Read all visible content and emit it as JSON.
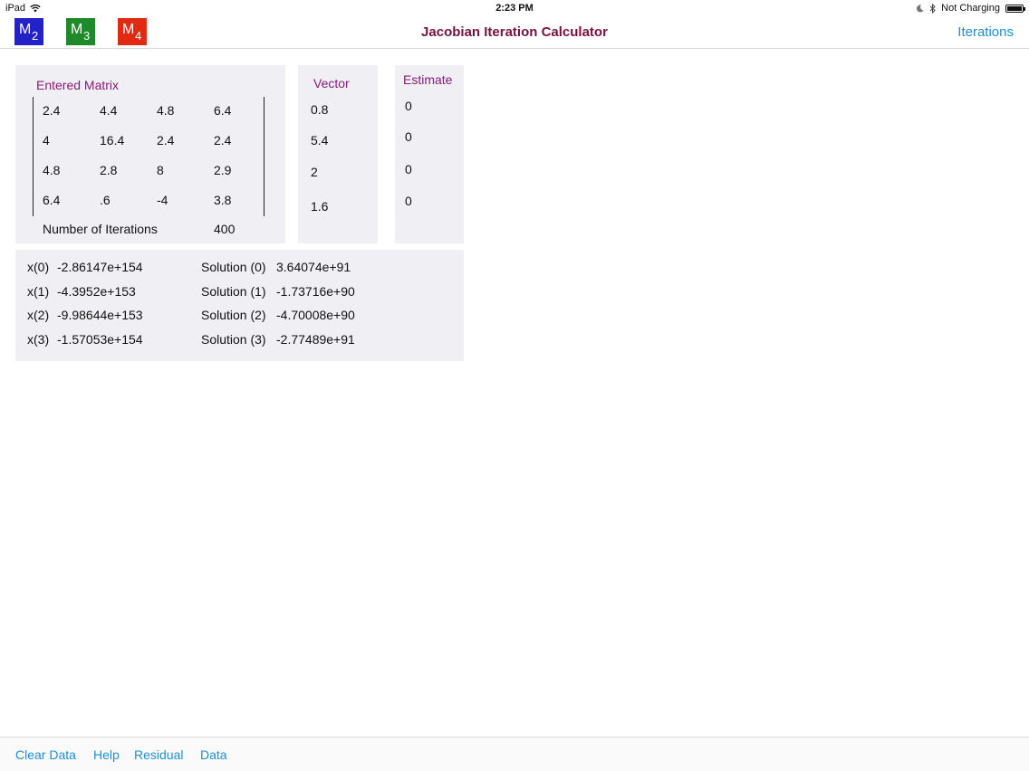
{
  "status_bar": {
    "device": "iPad",
    "time": "2:23 PM",
    "charging": "Not Charging"
  },
  "nav": {
    "title": "Jacobian Iteration Calculator",
    "right_button": "Iterations",
    "buttons": [
      {
        "letter": "M",
        "sub": "2",
        "color": "#2222c8"
      },
      {
        "letter": "M",
        "sub": "3",
        "color": "#1e8a2a"
      },
      {
        "letter": "M",
        "sub": "4",
        "color": "#e02a12"
      }
    ]
  },
  "matrix": {
    "title": "Entered Matrix",
    "rows": [
      [
        "2.4",
        "4.4",
        "4.8",
        "6.4"
      ],
      [
        "4",
        "16.4",
        "2.4",
        "2.4"
      ],
      [
        "4.8",
        "2.8",
        "8",
        "2.9"
      ],
      [
        "6.4",
        ".6",
        "-4",
        "3.8"
      ]
    ],
    "iterations_label": "Number of Iterations",
    "iterations_value": "400"
  },
  "vector": {
    "title": "Vector",
    "values": [
      "0.8",
      "5.4",
      "2",
      "1.6"
    ]
  },
  "estimate": {
    "title": "Estimate",
    "values": [
      "0",
      "0",
      "0",
      "0"
    ]
  },
  "results": {
    "x": [
      {
        "label": "x(0)",
        "value": "-2.86147e+154"
      },
      {
        "label": "x(1)",
        "value": "-4.3952e+153"
      },
      {
        "label": "x(2)",
        "value": "-9.98644e+153"
      },
      {
        "label": "x(3)",
        "value": "-1.57053e+154"
      }
    ],
    "solutions": [
      {
        "label": "Solution (0)",
        "value": "3.64074e+91"
      },
      {
        "label": "Solution (1)",
        "value": "-1.73716e+90"
      },
      {
        "label": "Solution (2)",
        "value": "-4.70008e+90"
      },
      {
        "label": "Solution (3)",
        "value": "-2.77489e+91"
      }
    ]
  },
  "toolbar": {
    "clear": "Clear Data",
    "help": "Help",
    "residual": "Residual",
    "data": "Data"
  },
  "colors": {
    "link": "#1d8fd6",
    "title": "#7a1040",
    "panel_title": "#8a1a7a",
    "panel_bg": "#efeff4"
  }
}
